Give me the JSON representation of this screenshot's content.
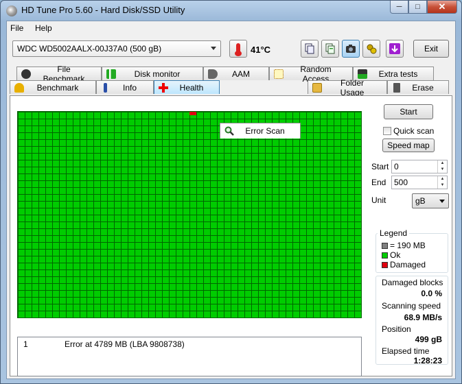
{
  "window": {
    "title": "HD Tune Pro 5.60 - Hard Disk/SSD Utility"
  },
  "menu": [
    {
      "label": "File"
    },
    {
      "label": "Help"
    }
  ],
  "toolbar": {
    "drive": "WDC WD5002AALX-00J37A0 (500 gB)",
    "temperature": "41°C",
    "exit_label": "Exit",
    "icons": [
      "copy-icon",
      "copy-all-icon",
      "camera-icon",
      "options-icon",
      "save-icon"
    ]
  },
  "tabs_top": [
    {
      "label": "File Benchmark",
      "icon": "file-benchmark-icon"
    },
    {
      "label": "Disk monitor",
      "icon": "disk-monitor-icon"
    },
    {
      "label": "AAM",
      "icon": "speaker-icon"
    },
    {
      "label": "Random Access",
      "icon": "random-access-icon"
    },
    {
      "label": "Extra tests",
      "icon": "extra-tests-icon"
    }
  ],
  "tabs_bottom": [
    {
      "label": "Benchmark",
      "icon": "benchmark-icon"
    },
    {
      "label": "Info",
      "icon": "info-icon"
    },
    {
      "label": "Health",
      "icon": "health-cross-icon"
    },
    {
      "label": "Error Scan",
      "icon": "magnifier-icon"
    },
    {
      "label": "Folder Usage",
      "icon": "folder-icon"
    },
    {
      "label": "Erase",
      "icon": "trash-icon"
    }
  ],
  "controls": {
    "start_label": "Start",
    "quick_scan_label": "Quick scan",
    "quick_scan_checked": false,
    "speed_map_label": "Speed map",
    "start_field_label": "Start",
    "start_value": "0",
    "end_field_label": "End",
    "end_value": "500",
    "unit_label": "Unit",
    "unit_value": "gB"
  },
  "legend": {
    "title": "Legend",
    "items": [
      {
        "label": "= 190 MB",
        "color": "#808080"
      },
      {
        "label": "Ok",
        "color": "#00cc00"
      },
      {
        "label": "Damaged",
        "color": "#e00010"
      }
    ]
  },
  "stats": {
    "damaged_blocks_label": "Damaged blocks",
    "damaged_blocks_value": "0.0 %",
    "scanning_speed_label": "Scanning speed",
    "scanning_speed_value": "68.9 MB/s",
    "position_label": "Position",
    "position_value": "499 gB",
    "elapsed_label": "Elapsed time",
    "elapsed_value": "1:28:23"
  },
  "log": [
    {
      "index": "1",
      "message": "Error at 4789 MB (LBA 9808738)"
    }
  ]
}
